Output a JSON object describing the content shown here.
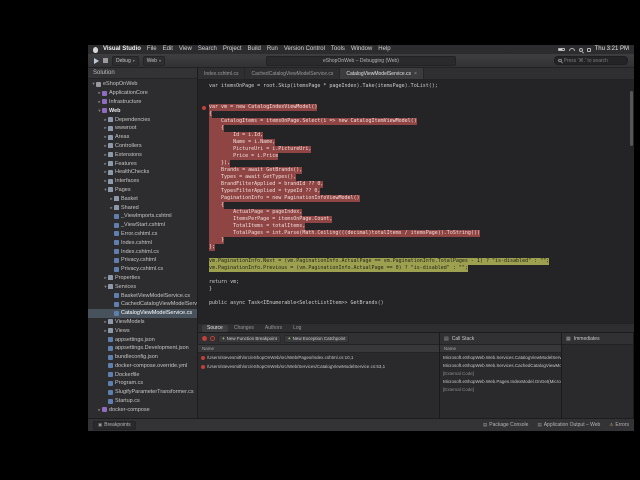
{
  "menu_bar": {
    "items": [
      "Visual Studio",
      "File",
      "Edit",
      "View",
      "Search",
      "Project",
      "Build",
      "Run",
      "Version Control",
      "Tools",
      "Window",
      "Help"
    ],
    "status_icons": [
      "battery-icon",
      "wifi-icon",
      "spotlight-icon",
      "notification-center-icon"
    ],
    "clock": "Thu 3:21 PM"
  },
  "toolbar": {
    "configuration": "Debug",
    "target": "Web",
    "status_text": "eShopOnWeb – Debugging (Web)",
    "search_placeholder": "Press '⌘.' to search"
  },
  "sidebar": {
    "title": "Solution",
    "items": [
      {
        "label": "eShopOnWeb",
        "depth": 0,
        "type": "solution",
        "expanded": true
      },
      {
        "label": "ApplicationCore",
        "depth": 1,
        "type": "project"
      },
      {
        "label": "Infrastructure",
        "depth": 1,
        "type": "project"
      },
      {
        "label": "Web",
        "depth": 1,
        "type": "project",
        "expanded": true,
        "bold": true
      },
      {
        "label": "Dependencies",
        "depth": 2,
        "type": "folder"
      },
      {
        "label": "wwwroot",
        "depth": 2,
        "type": "folder"
      },
      {
        "label": "Areas",
        "depth": 2,
        "type": "folder"
      },
      {
        "label": "Controllers",
        "depth": 2,
        "type": "folder"
      },
      {
        "label": "Extensions",
        "depth": 2,
        "type": "folder"
      },
      {
        "label": "Features",
        "depth": 2,
        "type": "folder"
      },
      {
        "label": "HealthChecks",
        "depth": 2,
        "type": "folder"
      },
      {
        "label": "Interfaces",
        "depth": 2,
        "type": "folder"
      },
      {
        "label": "Pages",
        "depth": 2,
        "type": "folder",
        "expanded": true
      },
      {
        "label": "Basket",
        "depth": 3,
        "type": "folder"
      },
      {
        "label": "Shared",
        "depth": 3,
        "type": "folder"
      },
      {
        "label": "_ViewImports.cshtml",
        "depth": 3,
        "type": "file"
      },
      {
        "label": "_ViewStart.cshtml",
        "depth": 3,
        "type": "file"
      },
      {
        "label": "Error.cshtml.cs",
        "depth": 3,
        "type": "file"
      },
      {
        "label": "Index.cshtml",
        "depth": 3,
        "type": "file"
      },
      {
        "label": "Index.cshtml.cs",
        "depth": 3,
        "type": "file"
      },
      {
        "label": "Privacy.cshtml",
        "depth": 3,
        "type": "file"
      },
      {
        "label": "Privacy.cshtml.cs",
        "depth": 3,
        "type": "file"
      },
      {
        "label": "Properties",
        "depth": 2,
        "type": "folder"
      },
      {
        "label": "Services",
        "depth": 2,
        "type": "folder",
        "expanded": true
      },
      {
        "label": "BasketViewModelService.cs",
        "depth": 3,
        "type": "file"
      },
      {
        "label": "CachedCatalogViewModelService.cs",
        "depth": 3,
        "type": "file"
      },
      {
        "label": "CatalogViewModelService.cs",
        "depth": 3,
        "type": "file",
        "selected": true
      },
      {
        "label": "ViewModels",
        "depth": 2,
        "type": "folder"
      },
      {
        "label": "Views",
        "depth": 2,
        "type": "folder"
      },
      {
        "label": "appsettings.json",
        "depth": 2,
        "type": "file"
      },
      {
        "label": "appsettings.Development.json",
        "depth": 2,
        "type": "file"
      },
      {
        "label": "bundleconfig.json",
        "depth": 2,
        "type": "file"
      },
      {
        "label": "docker-compose.override.yml",
        "depth": 2,
        "type": "file"
      },
      {
        "label": "Dockerfile",
        "depth": 2,
        "type": "file"
      },
      {
        "label": "Program.cs",
        "depth": 2,
        "type": "file"
      },
      {
        "label": "SlugifyParameterTransformer.cs",
        "depth": 2,
        "type": "file"
      },
      {
        "label": "Startup.cs",
        "depth": 2,
        "type": "file"
      },
      {
        "label": "docker-compose",
        "depth": 1,
        "type": "project"
      }
    ]
  },
  "tabs": [
    {
      "label": "Index.cshtml.cs",
      "active": false
    },
    {
      "label": "CachedCatalogViewModelService.cs",
      "active": false
    },
    {
      "label": "CatalogViewModelService.cs",
      "active": true
    }
  ],
  "editor": {
    "active_subtab": "Source",
    "subtabs": [
      "Source",
      "Changes",
      "Authors",
      "Log"
    ],
    "lines": [
      {
        "text": "var itemsOnPage = root.Skip(itemsPage * pageIndex).Take(itemsPage).ToList();"
      },
      {
        "text": ""
      },
      {
        "text": ""
      },
      {
        "text": "var vm = new CatalogIndexViewModel()",
        "hl": "red",
        "breakpoint": true
      },
      {
        "text": "{",
        "hl": "red"
      },
      {
        "text": "    CatalogItems = itemsOnPage.Select(i => new CatalogItemViewModel()",
        "hl": "red"
      },
      {
        "text": "    {",
        "hl": "red"
      },
      {
        "text": "        Id = i.Id,",
        "hl": "red"
      },
      {
        "text": "        Name = i.Name,",
        "hl": "red"
      },
      {
        "text": "        PictureUri = i.PictureUri,",
        "hl": "red"
      },
      {
        "text": "        Price = i.Price",
        "hl": "red"
      },
      {
        "text": "    }),",
        "hl": "red"
      },
      {
        "text": "    Brands = await GetBrands(),",
        "hl": "red"
      },
      {
        "text": "    Types = await GetTypes(),",
        "hl": "red"
      },
      {
        "text": "    BrandFilterApplied = brandId ?? 0,",
        "hl": "red"
      },
      {
        "text": "    TypesFilterApplied = typeId ?? 0,",
        "hl": "red"
      },
      {
        "text": "    PaginationInfo = new PaginationInfoViewModel()",
        "hl": "red"
      },
      {
        "text": "    {",
        "hl": "red"
      },
      {
        "text": "        ActualPage = pageIndex,",
        "hl": "red"
      },
      {
        "text": "        ItemsPerPage = itemsOnPage.Count,",
        "hl": "red"
      },
      {
        "text": "        TotalItems = totalItems,",
        "hl": "red"
      },
      {
        "text": "        TotalPages = int.Parse(Math.Ceiling(((decimal)totalItems / itemsPage)).ToString())",
        "hl": "red"
      },
      {
        "text": "    }",
        "hl": "red"
      },
      {
        "text": "};",
        "hl": "red"
      },
      {
        "text": ""
      },
      {
        "text": "vm.PaginationInfo.Next = (vm.PaginationInfo.ActualPage == vm.PaginationInfo.TotalPages - 1) ? \"is-disabled\" : \"\";",
        "hl": "yellow"
      },
      {
        "text": "vm.PaginationInfo.Previous = (vm.PaginationInfo.ActualPage == 0) ? \"is-disabled\" : \"\";",
        "hl": "yellow"
      },
      {
        "text": ""
      },
      {
        "text": "return vm;"
      },
      {
        "text": "}"
      },
      {
        "text": ""
      },
      {
        "text": "public async Task<IEnumerable<SelectListItem>> GetBrands()"
      },
      {
        "text": ""
      }
    ]
  },
  "breakpoints_pad": {
    "buttons": [
      "New Function Breakpoint",
      "New Exception Catchpoint"
    ],
    "column": "Name",
    "rows": [
      "/Users/stevesmith/src/eShopOnWeb/src/Web/Pages/Index.cshtml.cs:10,1",
      "/Users/stevesmith/src/eShopOnWeb/src/Web/Services/CatalogViewModelService.cs:53,1"
    ]
  },
  "callstack_pad": {
    "title": "Call Stack",
    "column": "Name",
    "rows": [
      "Microsoft.eShopWeb.Web.Services.CatalogViewModelService.GetCatalogItems(int pa",
      "Microsoft.eShopWeb.Web.Services.CachedCatalogViewModelService.GetCatalogItem",
      "[External Code]",
      "Microsoft.eShopWeb.Web.Pages.IndexModel.OnGet(Microsoft.eShopWeb.Web.ViewMo",
      "[External Code]"
    ]
  },
  "immediate_pad": {
    "title": "Immediates"
  },
  "status_bar": {
    "left_tab": "Breakpoints",
    "right_items": [
      {
        "label": "Package Console",
        "icon": "console-icon",
        "glyph": "▤"
      },
      {
        "label": "Application Output – Web",
        "icon": "output-icon",
        "glyph": "▤"
      },
      {
        "label": "Errors",
        "icon": "warning-icon",
        "glyph": "⚠"
      }
    ]
  }
}
